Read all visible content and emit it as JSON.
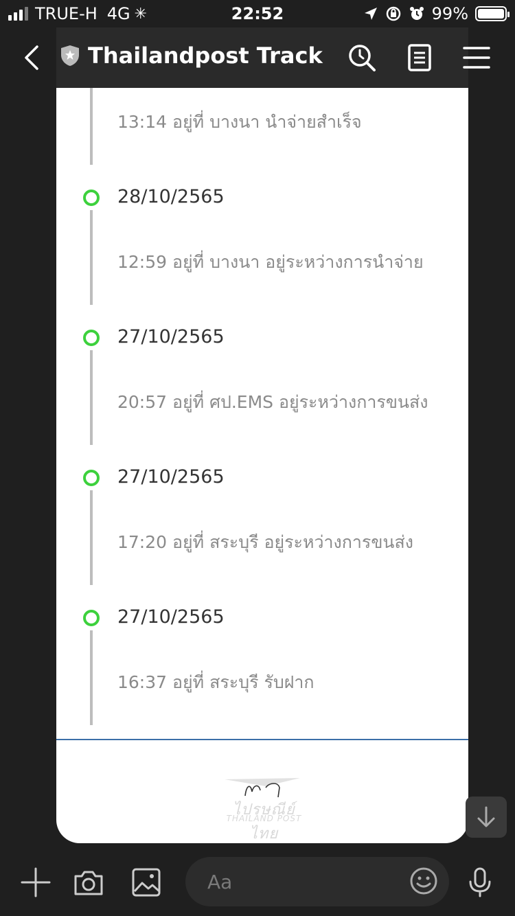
{
  "status_bar": {
    "carrier": "TRUE-H",
    "network": "4G",
    "time": "22:52",
    "battery_percent": "99%",
    "battery_level": 0.99,
    "signal_bars": 3
  },
  "header": {
    "title": "Thailandpost Track",
    "icons": [
      "back-chevron-icon",
      "shield-star-icon",
      "search-clock-icon",
      "notes-icon",
      "menu-icon"
    ]
  },
  "timeline": [
    {
      "date": "",
      "detail": "13:14 อยู่ที่ บางนา นำจ่ายสำเร็จ"
    },
    {
      "date": "28/10/2565",
      "detail": "12:59 อยู่ที่ บางนา อยู่ระหว่างการนำจ่าย"
    },
    {
      "date": "27/10/2565",
      "detail": "20:57 อยู่ที่ ศป.EMS อยู่ระหว่างการขนส่ง"
    },
    {
      "date": "27/10/2565",
      "detail": "17:20 อยู่ที่ สระบุรี อยู่ระหว่างการขนส่ง"
    },
    {
      "date": "27/10/2565",
      "detail": "16:37 อยู่ที่ สระบุรี รับฝาก"
    }
  ],
  "footer_logo": {
    "text": "ไปรษณีย์ไทย",
    "sub": "THAILAND POST"
  },
  "composer": {
    "placeholder": "Aa",
    "icons": [
      "plus-icon",
      "camera-icon",
      "image-icon",
      "emoji-icon",
      "microphone-icon"
    ]
  },
  "colors": {
    "accent_green": "#3dd13d",
    "divider_blue": "#3a6ea8",
    "background": "#1f1f1f"
  }
}
